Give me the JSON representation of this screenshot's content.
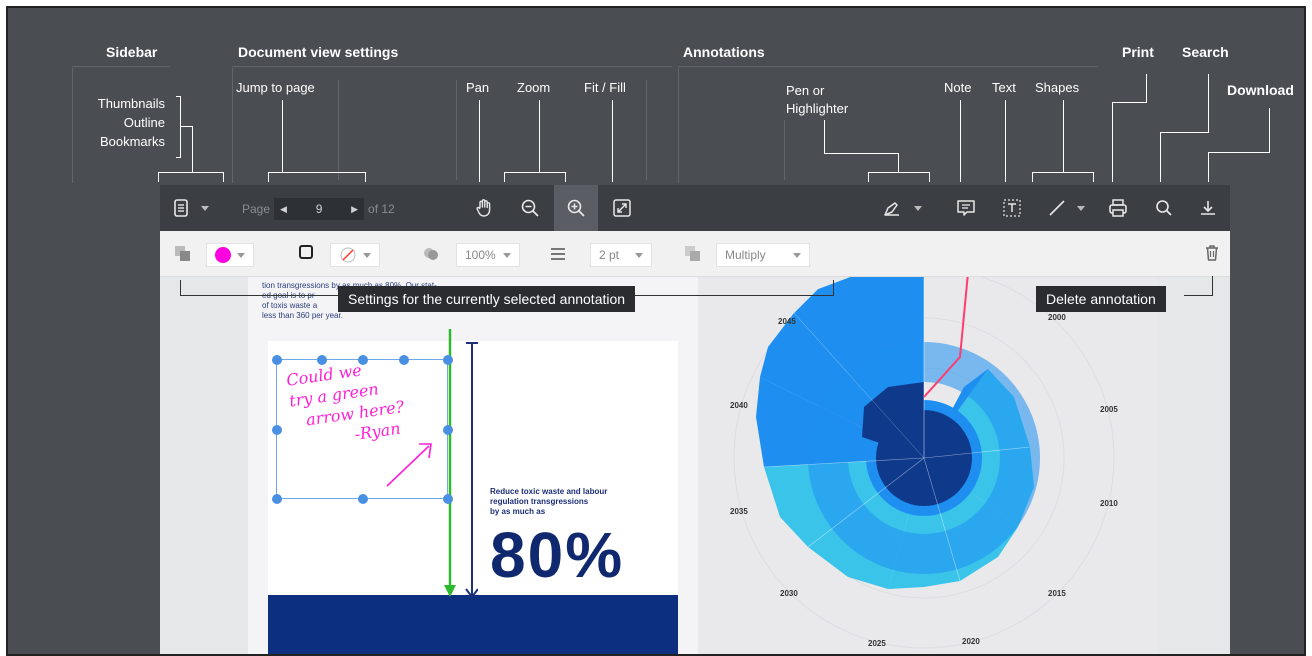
{
  "headers": {
    "sidebar": "Sidebar",
    "document_view": "Document view settings",
    "annotations": "Annotations",
    "print": "Print",
    "search": "Search",
    "download": "Download"
  },
  "sublabels": {
    "thumbnails": "Thumbnails",
    "outline": "Outline",
    "bookmarks": "Bookmarks",
    "jump_to_page": "Jump to page",
    "pan": "Pan",
    "zoom": "Zoom",
    "fit_fill": "Fit / Fill",
    "pen": "Pen or",
    "highlighter": "Highlighter",
    "note": "Note",
    "text": "Text",
    "shapes": "Shapes"
  },
  "toolbar": {
    "page_prefix": "Page",
    "page_current": "9",
    "page_total": "of 12"
  },
  "settings": {
    "fill_color": "#ff00e0",
    "opacity": "100%",
    "stroke_width": "2 pt",
    "blend_mode": "Multiply"
  },
  "tooltips": {
    "settings": "Settings for the currently selected annotation",
    "delete": "Delete annotation"
  },
  "document": {
    "body_line1": "tion transgressions by as much as 80%. Our stat-",
    "body_line2": "ed goal is to pr",
    "body_line3": "of toxis waste a",
    "body_line4": "less than 360 per year.",
    "callout_line1": "Reduce toxic waste and labour",
    "callout_line2": "regulation transgressions",
    "callout_line3": "by as much as",
    "big_percent": "80%",
    "handwriting": [
      "Could we",
      "try a green",
      "arrow here?",
      "-Ryan"
    ],
    "years": [
      "2045",
      "2040",
      "2035",
      "2030",
      "2025",
      "2020",
      "2015",
      "2010",
      "2005",
      "2000"
    ]
  }
}
